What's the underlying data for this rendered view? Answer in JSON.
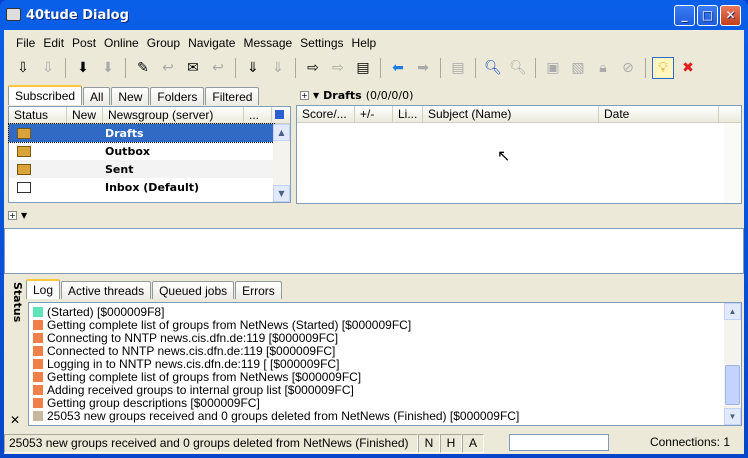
{
  "title": "40tude Dialog",
  "menu": [
    "File",
    "Edit",
    "Post",
    "Online",
    "Group",
    "Navigate",
    "Message",
    "Settings",
    "Help"
  ],
  "toolbar": [
    {
      "icon": "get-headers-icon",
      "glyph": "⇩"
    },
    {
      "icon": "get-headers-disabled-icon",
      "glyph": "⇩",
      "disabled": true
    },
    "sep",
    {
      "icon": "download-icon",
      "glyph": "⬇"
    },
    {
      "icon": "download-disabled-icon",
      "glyph": "⬇",
      "disabled": true
    },
    "sep",
    {
      "icon": "new-post-icon",
      "glyph": "✎"
    },
    {
      "icon": "reply-icon",
      "glyph": "↩",
      "disabled": true
    },
    {
      "icon": "email-icon",
      "glyph": "✉"
    },
    {
      "icon": "reply-email-icon",
      "glyph": "↩",
      "disabled": true
    },
    "sep",
    {
      "icon": "fetch-icon",
      "glyph": "⇓"
    },
    {
      "icon": "fetch-disabled-icon",
      "glyph": "⇓",
      "disabled": true
    },
    "sep",
    {
      "icon": "send-icon",
      "glyph": "⇨"
    },
    {
      "icon": "send-disabled-icon",
      "glyph": "⇨",
      "disabled": true
    },
    {
      "icon": "send-all-icon",
      "glyph": "▤"
    },
    "sep",
    {
      "icon": "back-icon",
      "glyph": "⬅",
      "color": "#1c7ce0"
    },
    {
      "icon": "forward-icon",
      "glyph": "➡",
      "disabled": true
    },
    "sep",
    {
      "icon": "article-icon",
      "glyph": "▤",
      "disabled": true
    },
    "sep",
    {
      "icon": "search-icon",
      "glyph": "🔍︎",
      "color": "#1c4fc0"
    },
    {
      "icon": "search-disabled-icon",
      "glyph": "🔍︎",
      "disabled": true
    },
    "sep",
    {
      "icon": "mark-read-icon",
      "glyph": "▣",
      "disabled": true
    },
    {
      "icon": "mark-icon",
      "glyph": "▧",
      "disabled": true
    },
    {
      "icon": "lock-icon",
      "glyph": "🔒︎",
      "disabled": true
    },
    {
      "icon": "ignore-icon",
      "glyph": "⊘",
      "disabled": true
    },
    "sep",
    {
      "icon": "lightbulb-icon",
      "glyph": "💡︎",
      "active": true,
      "color": "#d0a000"
    },
    {
      "icon": "stop-icon",
      "glyph": "✖",
      "color": "#e02020"
    }
  ],
  "groups": {
    "tabs": [
      "Subscribed",
      "All",
      "New",
      "Folders",
      "Filtered"
    ],
    "columns": [
      "Status",
      "New",
      "Newsgroup (server)",
      "..."
    ],
    "rows": [
      {
        "name": "Drafts",
        "icon": "folder"
      },
      {
        "name": "Outbox",
        "icon": "folder"
      },
      {
        "name": "Sent",
        "icon": "folder"
      },
      {
        "name": "Inbox (Default)",
        "icon": "inbox"
      }
    ]
  },
  "messages": {
    "group": "Drafts",
    "counts": "(0/0/0/0)",
    "columns": [
      "Score/...",
      "+/-",
      "Li...",
      "Subject (Name)",
      "Date"
    ]
  },
  "status": {
    "side_label": "Status",
    "tabs": [
      "Log",
      "Active threads",
      "Queued jobs",
      "Errors"
    ],
    "log": [
      {
        "text": " (Started) [$000009F8]",
        "color": "#5ce6b8"
      },
      {
        "text": "Getting complete list of groups from NetNews (Started) [$000009FC]",
        "color": "#f08048"
      },
      {
        "text": "Connecting to NNTP news.cis.dfn.de:119 [$000009FC]",
        "color": "#f08048"
      },
      {
        "text": "Connected to NNTP news.cis.dfn.de:119 [$000009FC]",
        "color": "#f08048"
      },
      {
        "text": "Logging in to NNTP news.cis.dfn.de:119 [ [$000009FC]",
        "color": "#f08048"
      },
      {
        "text": "Getting complete list of groups from NetNews [$000009FC]",
        "color": "#f08048"
      },
      {
        "text": "Adding received groups to internal group list [$000009FC]",
        "color": "#f08048"
      },
      {
        "text": "Getting group descriptions [$000009FC]",
        "color": "#f08048"
      },
      {
        "text": "25053 new groups received and 0 groups deleted from NetNews (Finished) [$000009FC]",
        "color": "#c8b8a0"
      }
    ]
  },
  "statusbar": {
    "message": "25053 new groups received and 0 groups deleted from NetNews (Finished)",
    "flags": [
      "N",
      "H",
      "A"
    ],
    "input": "",
    "connections": "Connections: 1"
  }
}
